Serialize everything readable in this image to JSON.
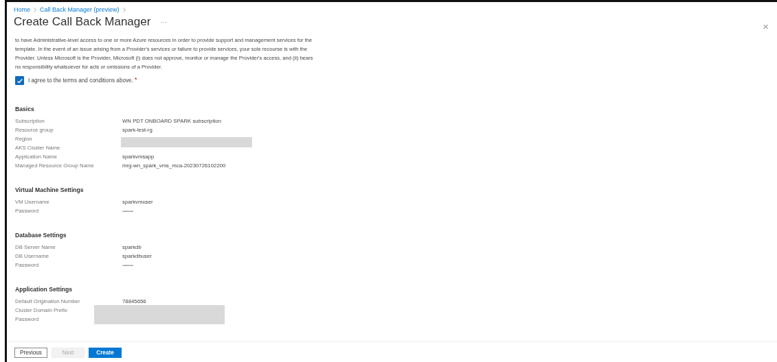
{
  "breadcrumb": [
    {
      "label": "Home"
    },
    {
      "label": "Call Back Manager (preview)"
    }
  ],
  "title": "Create Call Back Manager",
  "more_button": "···",
  "close_button": "×",
  "terms_text": "to have Administrative-level access to one or more Azure resources in order to provide support and management services for the template. In the event of an issue arising from a Provider's services or failure to provide services, your sole recourse is with the Provider. Unless Microsoft is the Provider, Microsoft (i) does not approve, monitor or manage the Provider's access, and (ii) bears no responsibility whatsoever for acts or omissions of a Provider.",
  "agree": {
    "label": "I agree to the terms and conditions above.",
    "checked": true,
    "required_mark": "*"
  },
  "sections": [
    {
      "heading": "Basics",
      "rows": [
        {
          "label": "Subscription",
          "kind": "text",
          "value": "WN PDT ONBOARD SPARK subscription"
        },
        {
          "label": "Resource group",
          "kind": "text",
          "value": "spark-test-rg"
        },
        {
          "label": "Region",
          "kind": "redacted_span"
        },
        {
          "label": "AKS Cluster Name",
          "kind": "covered"
        },
        {
          "label": "Application Name",
          "kind": "text",
          "value": "sparkvmsapp"
        },
        {
          "label": "Managed Resource Group Name",
          "kind": "text",
          "value": "mrg-wn_spark_vms_mca-20230726102200"
        }
      ]
    },
    {
      "heading": "Virtual Machine Settings",
      "rows": [
        {
          "label": "VM Username",
          "kind": "text",
          "value": "sparkvmuser"
        },
        {
          "label": "Password",
          "kind": "secret",
          "value": "••••••••••••••"
        }
      ]
    },
    {
      "heading": "Database Settings",
      "rows": [
        {
          "label": "DB Server Name",
          "kind": "text",
          "value": "sparkdb"
        },
        {
          "label": "DB Username",
          "kind": "text",
          "value": "sparkdbuser"
        },
        {
          "label": "Password",
          "kind": "secret",
          "value": "••••••••••••••"
        }
      ]
    },
    {
      "heading": "Application Settings",
      "rows": [
        {
          "label": "Default Origination Number",
          "kind": "text",
          "value": "78845656"
        },
        {
          "label": "Cluster Domain Prefix",
          "kind": "redacted"
        },
        {
          "label": "Password",
          "kind": "redacted"
        }
      ]
    }
  ],
  "buttons": [
    {
      "label": "Previous",
      "kind": "secondary",
      "disabled": false
    },
    {
      "label": "Next",
      "kind": "secondary",
      "disabled": true
    },
    {
      "label": "Create",
      "kind": "primary",
      "disabled": false
    }
  ]
}
